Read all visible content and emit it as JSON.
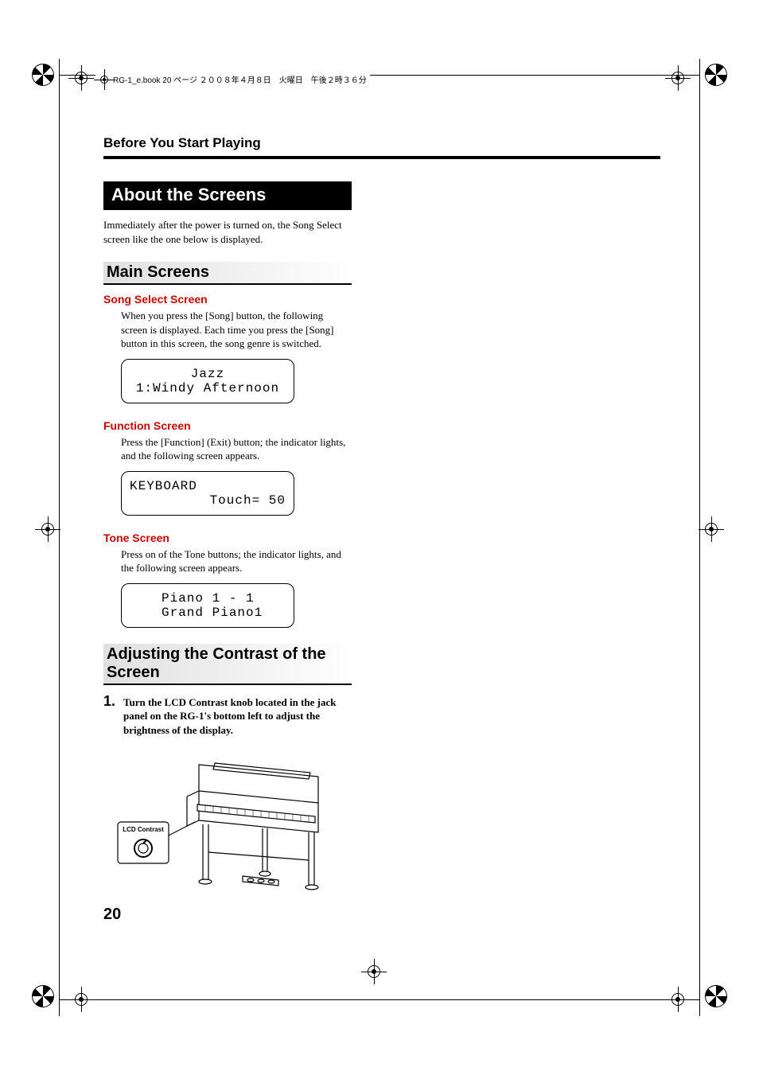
{
  "header_note": "RG-1_e.book 20 ページ ２００８年４月８日　火曜日　午後２時３６分",
  "chapter_title": "Before You Start Playing",
  "h1": "About the Screens",
  "intro": "Immediately after the power is turned on, the Song Select screen like the one below is displayed.",
  "main_screens": {
    "title": "Main Screens",
    "song_select": {
      "heading": "Song Select Screen",
      "body": "When you press the [Song] button, the following screen is displayed. Each time you press the [Song] button in this screen, the song genre is switched.",
      "lcd_line1": "Jazz",
      "lcd_line2": "1:Windy Afternoon"
    },
    "function": {
      "heading": "Function Screen",
      "body": "Press the [Function] (Exit) button; the indicator lights, and the following screen appears.",
      "lcd_line1": "KEYBOARD",
      "lcd_line2": "Touch= 50"
    },
    "tone": {
      "heading": "Tone Screen",
      "body": "Press on of the Tone buttons; the indicator lights, and the following screen appears.",
      "lcd_line1": "Piano 1 - 1",
      "lcd_line2": "Grand Piano1"
    }
  },
  "contrast": {
    "title": "Adjusting the Contrast of the Screen",
    "step1_num": "1.",
    "step1_text": "Turn the LCD Contrast knob located in the jack panel on the RG-1's bottom left to adjust the brightness of the display.",
    "callout_label": "LCD Contrast"
  },
  "page_number": "20"
}
